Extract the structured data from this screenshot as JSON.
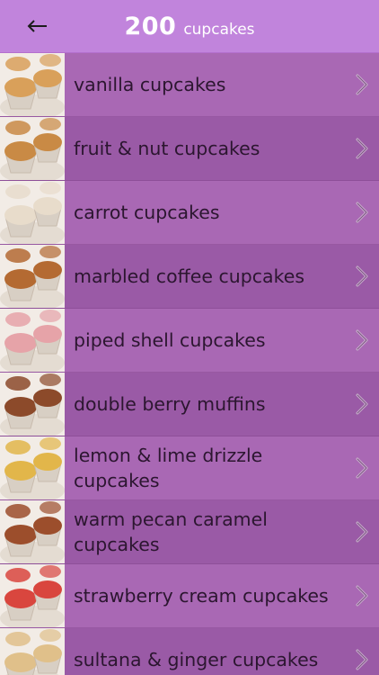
{
  "header": {
    "back_icon": "arrow-left-icon",
    "title_number": "200",
    "title_word": "cupcakes"
  },
  "recipes": [
    {
      "label": "vanilla cupcakes",
      "image": "vanilla-cupcakes-photo",
      "tint": "#d9a05a"
    },
    {
      "label": "fruit & nut cupcakes",
      "image": "fruit-nut-cupcakes-photo",
      "tint": "#c98a45"
    },
    {
      "label": "carrot cupcakes",
      "image": "carrot-cupcakes-photo",
      "tint": "#e8dccb"
    },
    {
      "label": "marbled coffee cupcakes",
      "image": "marbled-coffee-cupcakes-photo",
      "tint": "#b46a32"
    },
    {
      "label": "piped shell cupcakes",
      "image": "piped-shell-cupcakes-photo",
      "tint": "#e6a3a8"
    },
    {
      "label": "double berry muffins",
      "image": "double-berry-muffins-photo",
      "tint": "#8c4a2a"
    },
    {
      "label": "lemon & lime drizzle cupcakes",
      "image": "lemon-lime-cupcakes-photo",
      "tint": "#e2b64a"
    },
    {
      "label": "warm pecan caramel cupcakes",
      "image": "pecan-caramel-cupcakes-photo",
      "tint": "#9c4e2c"
    },
    {
      "label": "strawberry cream cupcakes",
      "image": "strawberry-cream-cupcakes-photo",
      "tint": "#d9463e"
    },
    {
      "label": "sultana & ginger cupcakes",
      "image": "sultana-ginger-cupcakes-photo",
      "tint": "#e0c08a"
    }
  ],
  "chevron_icon": "chevron-right-icon"
}
